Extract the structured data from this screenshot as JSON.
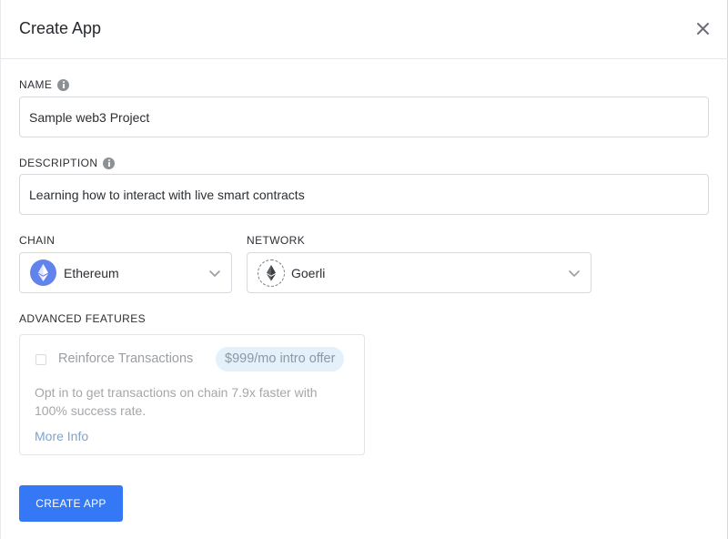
{
  "modal": {
    "title": "Create App"
  },
  "form": {
    "name": {
      "label": "NAME",
      "value": "Sample web3 Project"
    },
    "description": {
      "label": "DESCRIPTION",
      "value": "Learning how to interact with live smart contracts"
    },
    "chain": {
      "label": "CHAIN",
      "selected": "Ethereum",
      "icon": "ethereum-icon",
      "icon_color": "#6283ec"
    },
    "network": {
      "label": "NETWORK",
      "selected": "Goerli",
      "icon": "ethereum-icon"
    }
  },
  "advanced": {
    "label": "ADVANCED FEATURES",
    "feature_title": "Reinforce Transactions",
    "offer": "$999/mo intro offer",
    "description": "Opt in to get transactions on chain 7.9x faster with 100% success rate.",
    "more_info": "More Info",
    "checked": false
  },
  "actions": {
    "create_label": "CREATE APP",
    "accent_color": "#3478f6"
  }
}
